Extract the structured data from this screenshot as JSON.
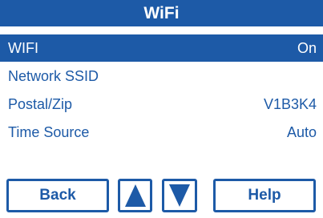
{
  "header": {
    "title": "WiFi"
  },
  "menu": {
    "items": [
      {
        "label": "WIFI",
        "value": "On",
        "selected": true
      },
      {
        "label": "Network SSID",
        "value": "",
        "selected": false
      },
      {
        "label": "Postal/Zip",
        "value": "V1B3K4",
        "selected": false
      },
      {
        "label": "Time Source",
        "value": "Auto",
        "selected": false
      }
    ]
  },
  "buttons": {
    "back_label": "Back",
    "up_icon": "arrow-up-icon",
    "down_icon": "arrow-down-icon",
    "help_label": "Help"
  },
  "colors": {
    "accent": "#1d5aa7",
    "background": "#ffffff",
    "selected_text": "#ffffff"
  }
}
